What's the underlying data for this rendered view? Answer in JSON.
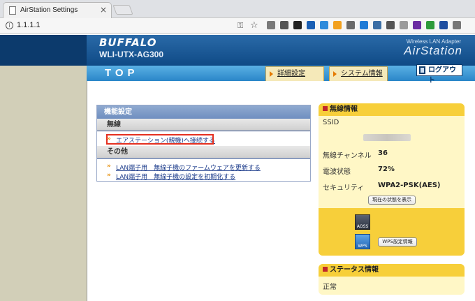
{
  "browser": {
    "tab_title": "AirStation Settings",
    "tab_close": "×",
    "url": "1.1.1.1",
    "info": "i",
    "extensions": [
      "#7a7a7a",
      "#555",
      "#222",
      "#1a5fb4",
      "#2e8bdb",
      "#f2a11f",
      "#6a6a6a",
      "#1f7bd6",
      "#3b6ea5",
      "#555",
      "#9a9a9a",
      "#6b2ca2",
      "#2e9b3b",
      "#1f4fa0",
      "#777"
    ]
  },
  "header": {
    "brand": "BUFFALO",
    "model": "WLI-UTX-AG300",
    "subtitle": "Wireless LAN Adapter",
    "product": "AirStation",
    "page_title": "TOP",
    "nav": [
      "詳細設定",
      "システム情報"
    ],
    "logout": "ログアウト"
  },
  "func": {
    "title": "機能設定",
    "sections": [
      {
        "label": "無線",
        "links": [
          "エアステーション(親機)へ接続する"
        ]
      },
      {
        "label": "その他",
        "links": [
          "LAN端子用　無線子機のファームウェアを更新する",
          "LAN端子用　無線子機の設定を初期化する"
        ]
      }
    ]
  },
  "wireless": {
    "title": "無線情報",
    "ssid_label": "SSID",
    "channel_label": "無線チャンネル",
    "channel_value": "36",
    "signal_label": "電波状態",
    "signal_value": "72%",
    "security_label": "セキュリティ",
    "security_value": "WPA2-PSK(AES)",
    "status_button": "現在の状態を表示",
    "aoss_label": "AOSS",
    "wps_label": "WPS",
    "wps_button": "WPS設定情報"
  },
  "status": {
    "title": "ステータス情報",
    "value": "正常"
  }
}
